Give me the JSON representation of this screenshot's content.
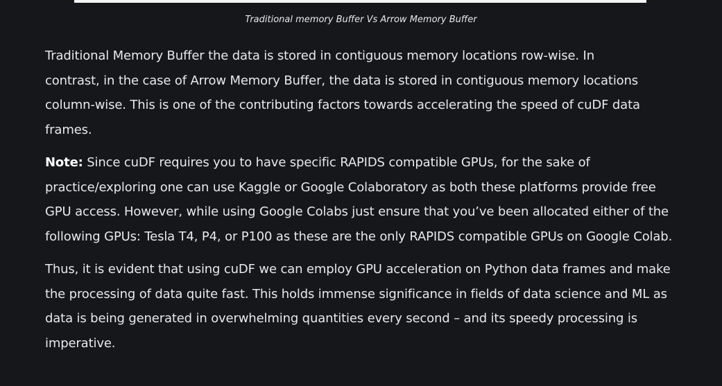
{
  "figure": {
    "caption": "Traditional memory Buffer Vs Arrow Memory Buffer"
  },
  "paragraphs": {
    "p1": "Traditional Memory Buffer the data is stored in contiguous memory locations row-wise. In contrast, in the case of Arrow Memory Buffer, the data is stored in contiguous memory locations column-wise. This is one of the contributing factors towards accelerating the speed of cuDF data frames.",
    "note_label": "Note:",
    "note_text": " Since cuDF requires you to have specific RAPIDS compatible GPUs, for the sake of practice/exploring one can use Kaggle or Google Colaboratory as both these platforms provide free GPU access. However, while using Google Colabs just ensure that you’ve been allocated either of the following GPUs: Tesla T4, P4, or P100 as these are the only RAPIDS compatible GPUs on Google Colab.",
    "p3": "Thus, it is evident that using cuDF we can employ GPU acceleration on Python data frames and make the processing of data quite fast. This holds immense significance in fields of data science and ML as data is being generated in overwhelming quantities every second – and its speedy processing is imperative."
  },
  "colors": {
    "background": "#16171b",
    "text": "#e8e9ec"
  }
}
